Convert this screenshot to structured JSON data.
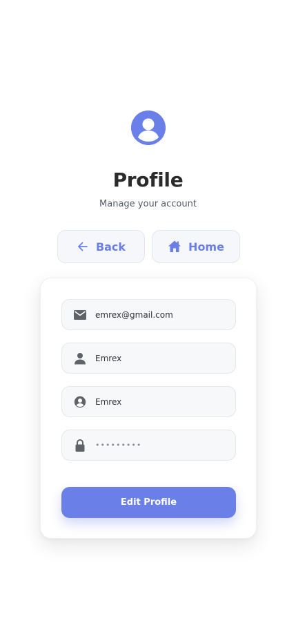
{
  "header": {
    "title": "Profile",
    "subtitle": "Manage your account"
  },
  "nav": {
    "back_label": "Back",
    "home_label": "Home"
  },
  "form": {
    "email": "emrex@gmail.com",
    "name": "Emrex",
    "username": "Emrex",
    "password_masked": "•••••••••"
  },
  "actions": {
    "edit_label": "Edit Profile"
  },
  "icons": {
    "avatar": "user-circle-icon",
    "back": "arrow-left-icon",
    "home": "home-icon",
    "email": "mail-icon",
    "name": "person-icon",
    "username": "account-circle-icon",
    "password": "lock-icon"
  },
  "colors": {
    "accent": "#6b7fe8",
    "title": "#2b2b2b",
    "field_bg": "#f7f8fa",
    "icon_gray": "#5f6368"
  }
}
